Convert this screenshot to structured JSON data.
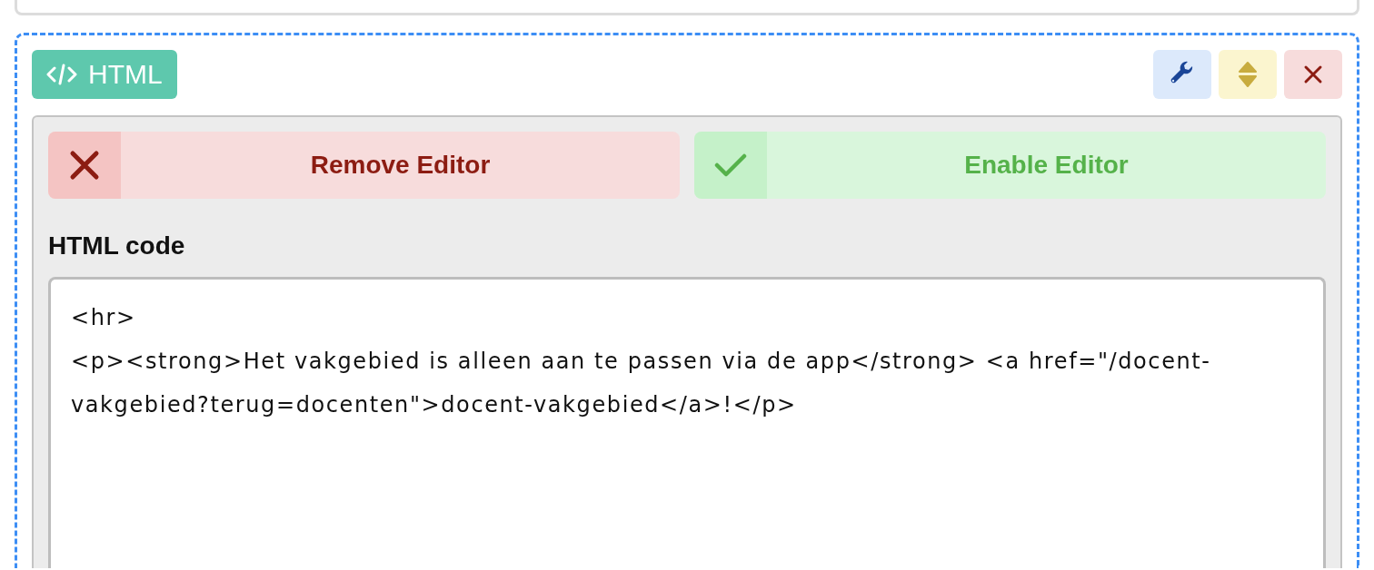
{
  "block": {
    "type_badge": {
      "label": "HTML"
    },
    "actions": [
      {
        "kind": "settings"
      },
      {
        "kind": "move"
      },
      {
        "kind": "delete"
      }
    ],
    "editor_buttons": [
      {
        "kind": "remove",
        "label": "Remove Editor"
      },
      {
        "kind": "enable",
        "label": "Enable Editor"
      }
    ],
    "field": {
      "label": "HTML code",
      "value": "<hr>\n<p><strong>Het vakgebied is alleen aan te passen via de app</strong> <a href=\"/docent-vakgebied?terug=docenten\">docent-vakgebied</a>!</p>"
    }
  }
}
